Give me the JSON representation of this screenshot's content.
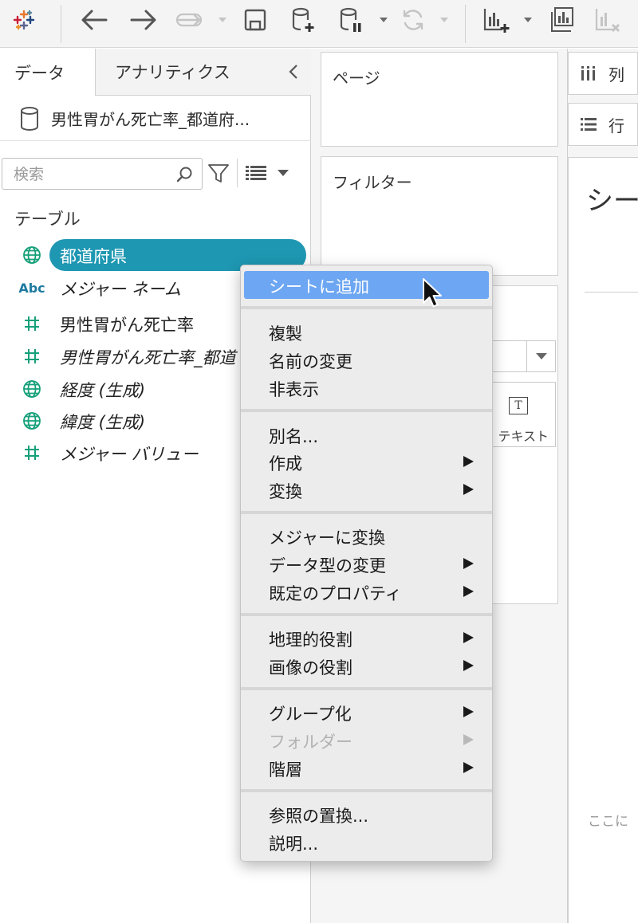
{
  "toolbar": {
    "buttons": [
      "tableau-logo-icon",
      "undo-icon",
      "redo-icon",
      "replay-icon",
      "save-icon",
      "new-datasource-icon",
      "pause-updates-icon",
      "refresh-icon",
      "new-worksheet-icon",
      "duplicate-sheet-icon",
      "clear-sheet-icon"
    ]
  },
  "data_pane": {
    "tab_data": "データ",
    "tab_analytics": "アナリティクス",
    "datasource_name": "男性胃がん死亡率_都道府...",
    "search_placeholder": "検索",
    "section_title": "テーブル",
    "fields": [
      {
        "label": "都道府県",
        "icon": "globe-icon",
        "selected": true
      },
      {
        "label": "メジャー ネーム",
        "icon": "Abc"
      },
      {
        "label": "男性胃がん死亡率",
        "icon": "hash-icon"
      },
      {
        "label": "男性胃がん死亡率_都道",
        "icon": "hash-icon"
      },
      {
        "label": "経度 (生成)",
        "icon": "globe-icon"
      },
      {
        "label": "緯度 (生成)",
        "icon": "globe-icon"
      },
      {
        "label": "メジャー バリュー",
        "icon": "hash-icon"
      }
    ]
  },
  "shelves": {
    "pages": "ページ",
    "filters": "フィルター",
    "text_card": "テキスト",
    "columns": "列",
    "rows": "行"
  },
  "sheet": {
    "title": "シー",
    "drop_hint": "ここに"
  },
  "context_menu": {
    "items": [
      {
        "label": "シートに追加",
        "highlighted": true
      },
      {
        "label": "複製"
      },
      {
        "label": "名前の変更"
      },
      {
        "label": "非表示"
      },
      {
        "label": "別名..."
      },
      {
        "label": "作成",
        "submenu": true
      },
      {
        "label": "変換",
        "submenu": true
      },
      {
        "label": "メジャーに変換"
      },
      {
        "label": "データ型の変更",
        "submenu": true
      },
      {
        "label": "既定のプロパティ",
        "submenu": true
      },
      {
        "label": "地理的役割",
        "submenu": true
      },
      {
        "label": "画像の役割",
        "submenu": true
      },
      {
        "label": "グループ化",
        "submenu": true
      },
      {
        "label": "フォルダー",
        "submenu": true,
        "disabled": true
      },
      {
        "label": "階層",
        "submenu": true
      },
      {
        "label": "参照の置換..."
      },
      {
        "label": "説明..."
      }
    ]
  },
  "colors": {
    "accent_pill": "#1e97b2",
    "menu_highlight": "#6da6f2",
    "measure_icon": "#16a07a"
  }
}
